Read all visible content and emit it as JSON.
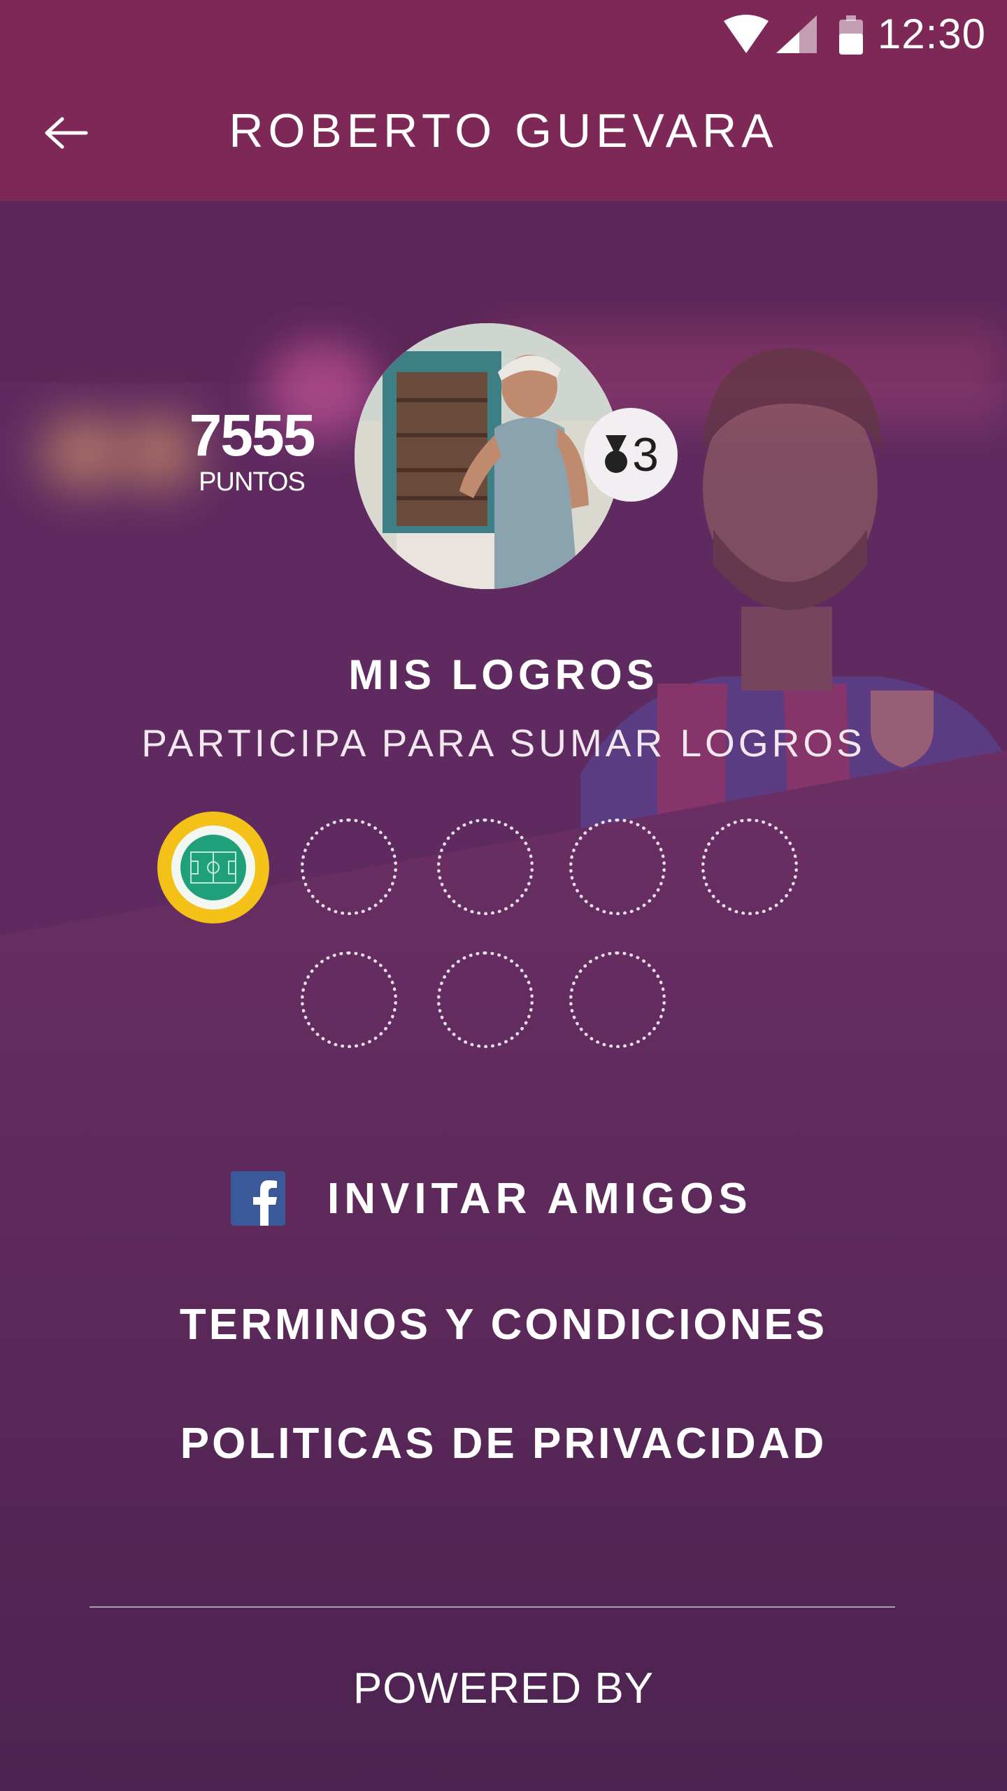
{
  "status_bar": {
    "time": "12:30"
  },
  "header": {
    "title": "ROBERTO GUEVARA",
    "back_icon": "arrow-left-icon"
  },
  "profile": {
    "points_value": "7555",
    "points_label": "PUNTOS",
    "level": "3",
    "level_icon": "medal-icon"
  },
  "achievements": {
    "title": "MIS LOGROS",
    "subtitle": "PARTICIPA PARA SUMAR LOGROS",
    "total": 8,
    "earned": 1
  },
  "menu": {
    "invite_label": "INVITAR AMIGOS",
    "invite_icon": "facebook-icon",
    "terms_label": "TERMINOS Y CONDICIONES",
    "privacy_label": "POLITICAS DE PRIVACIDAD"
  },
  "footer": {
    "powered_label": "POWERED BY"
  },
  "colors": {
    "header": "#7d2857",
    "background": "#5a2a57",
    "badge_gold": "#f4c119",
    "pitch_green": "#1fa07a",
    "facebook": "#3b5998"
  }
}
